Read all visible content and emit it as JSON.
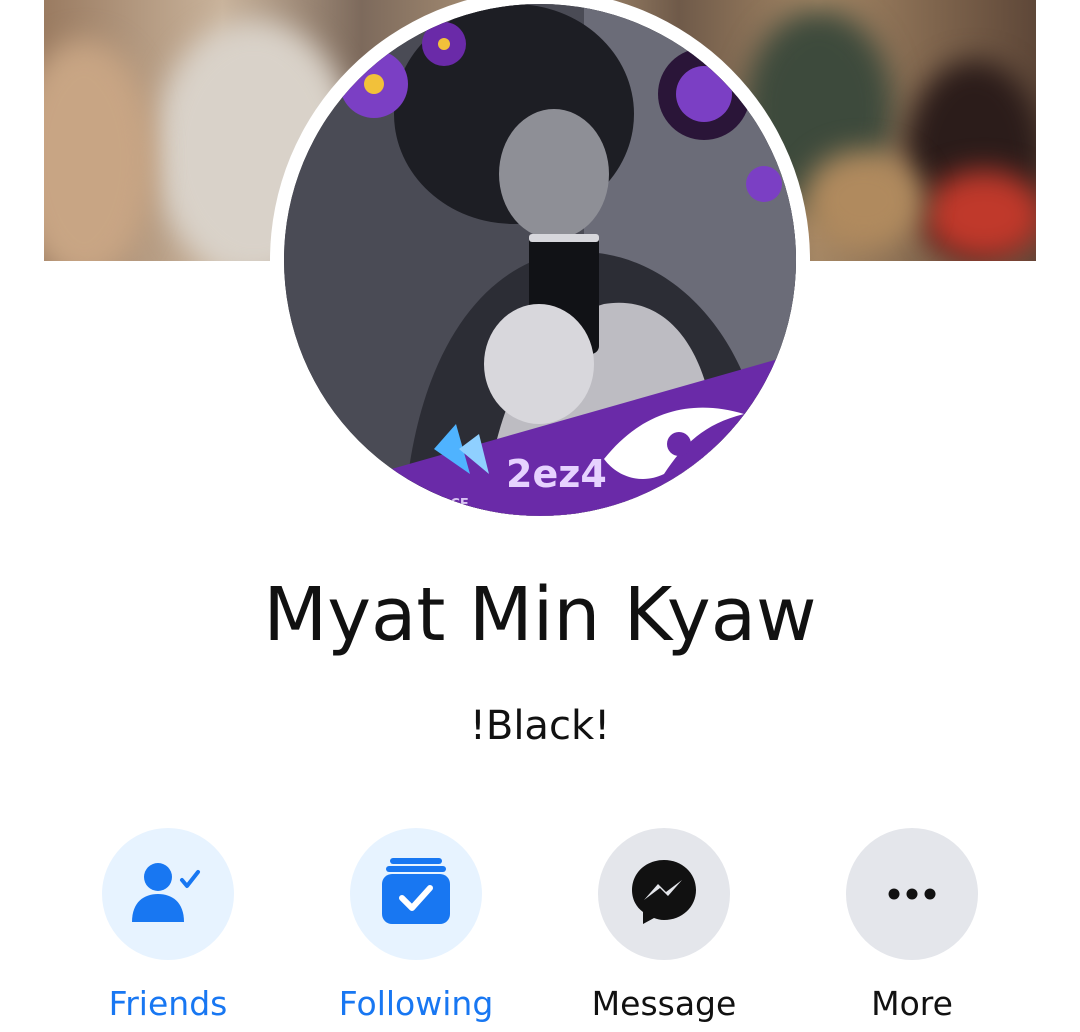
{
  "profile": {
    "name": "Myat Min Kyaw",
    "bio": "!Black!",
    "avatar_badge_text": "2ez4",
    "avatar_badge_subtext": "LACE"
  },
  "actions": [
    {
      "label": "Friends",
      "icon": "friends-check-icon",
      "color": "#1877f2"
    },
    {
      "label": "Following",
      "icon": "following-check-icon",
      "color": "#1877f2"
    },
    {
      "label": "Message",
      "icon": "messenger-icon",
      "color": "#111111"
    },
    {
      "label": "More",
      "icon": "more-dots-icon",
      "color": "#111111"
    }
  ],
  "colors": {
    "accent": "#1877f2",
    "accent_bg": "#e7f3ff",
    "neutral_bg": "#e4e6eb",
    "badge_purple": "#6a2aa8"
  }
}
